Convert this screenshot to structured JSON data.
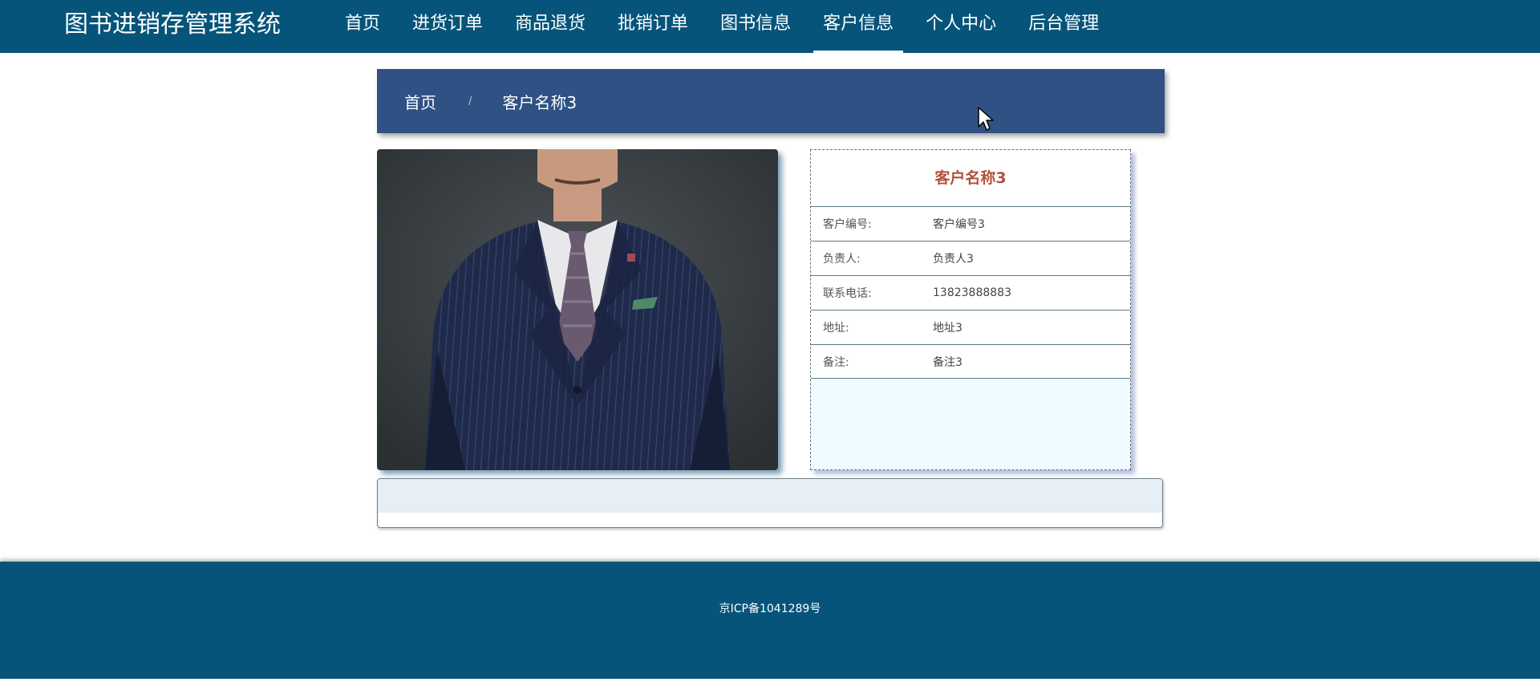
{
  "header": {
    "brand": "图书进销存管理系统",
    "nav": [
      {
        "label": "首页"
      },
      {
        "label": "进货订单"
      },
      {
        "label": "商品退货"
      },
      {
        "label": "批销订单"
      },
      {
        "label": "图书信息"
      },
      {
        "label": "客户信息",
        "active": true
      },
      {
        "label": "个人中心"
      },
      {
        "label": "后台管理"
      }
    ]
  },
  "breadcrumb": {
    "home": "首页",
    "separator": "/",
    "current": "客户名称3"
  },
  "customer": {
    "title": "客户名称3",
    "fields": [
      {
        "label": "客户编号:",
        "value": "客户编号3"
      },
      {
        "label": "负责人:",
        "value": "负责人3"
      },
      {
        "label": "联系电话:",
        "value": "13823888883"
      },
      {
        "label": "地址:",
        "value": "地址3"
      },
      {
        "label": "备注:",
        "value": "备注3"
      }
    ]
  },
  "footer": {
    "icp": "京ICP备1041289号"
  },
  "colors": {
    "header_bg": "#06547a",
    "breadcrumb_bg": "#2f5183",
    "title_red": "#b0523a",
    "panel_bg": "#f0fbff",
    "detail_bg": "#e6eff6"
  },
  "icons": {
    "cursor": "mouse-pointer-icon"
  }
}
